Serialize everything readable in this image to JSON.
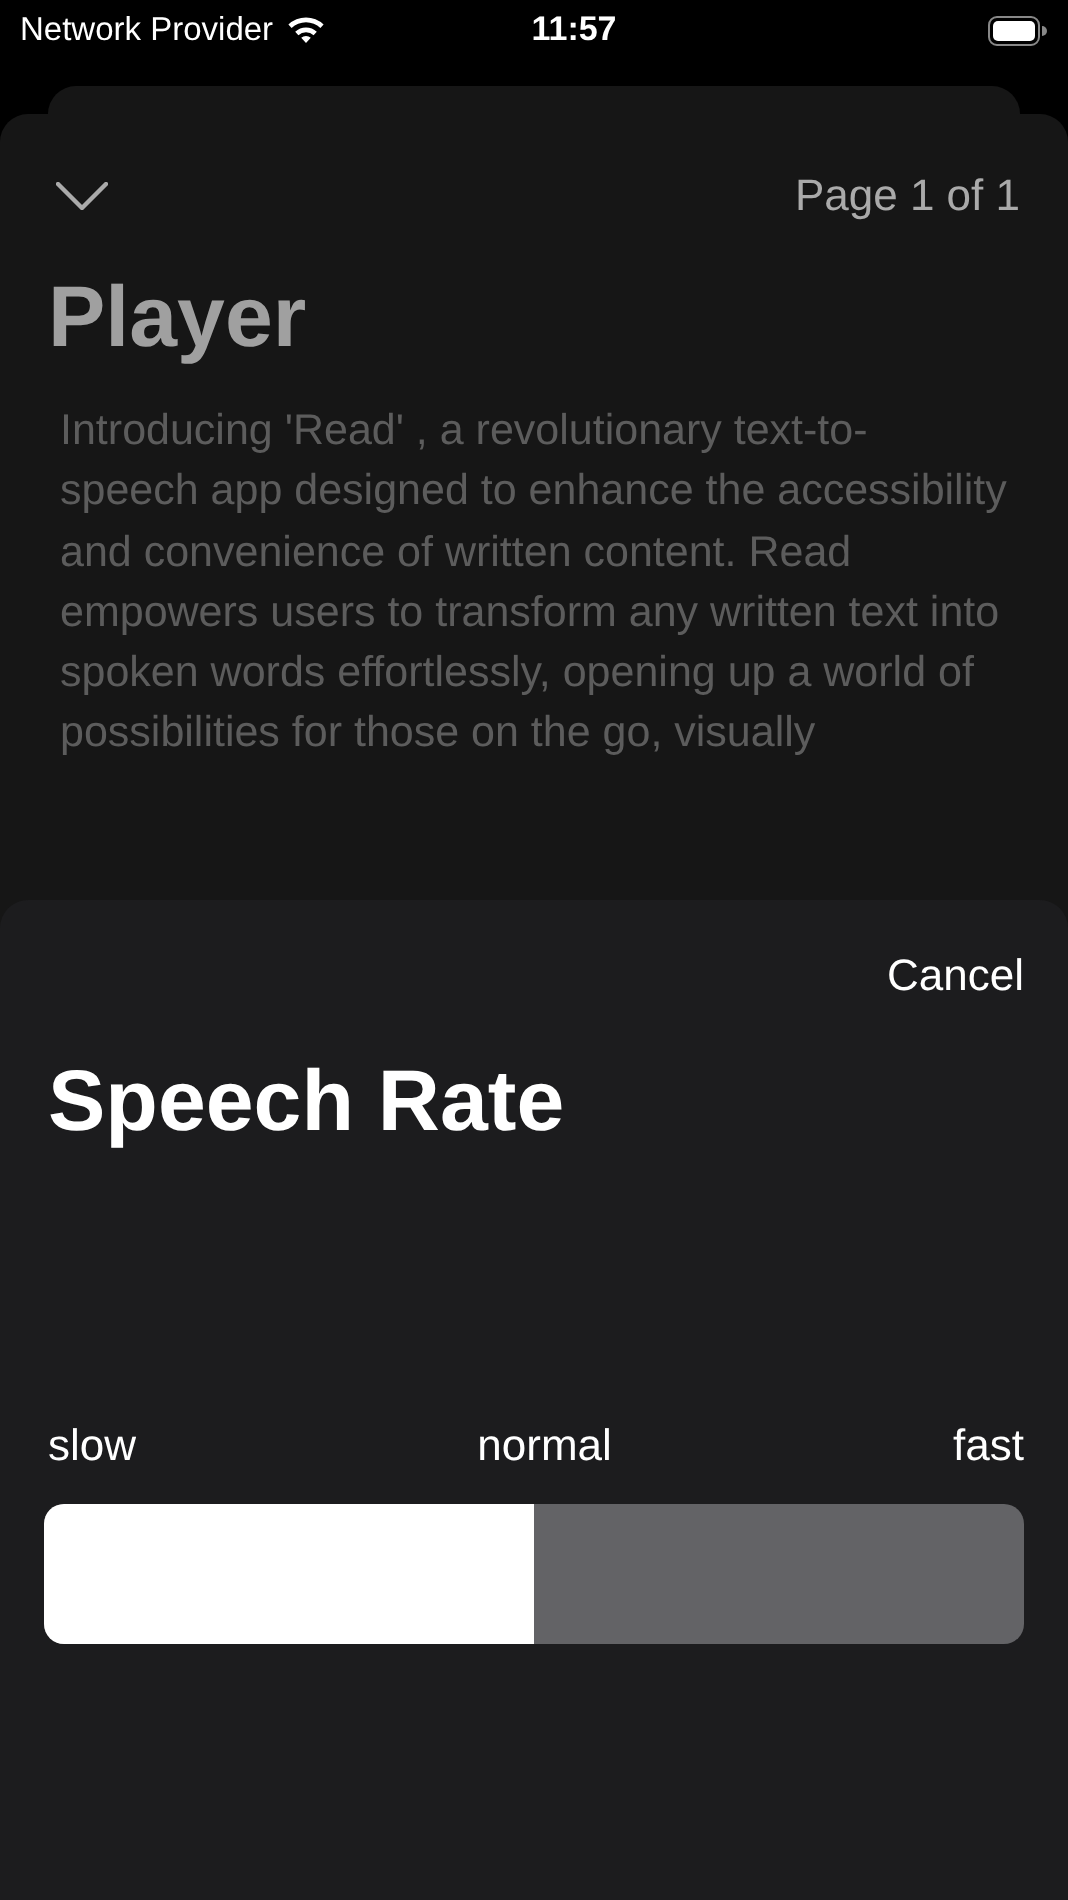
{
  "status_bar": {
    "carrier": "Network Provider",
    "time": "11:57"
  },
  "player": {
    "page_indicator": "Page 1 of 1",
    "title": "Player",
    "body": "Introducing 'Read' , a revolutionary text-to- speech app designed to enhance the accessibility and convenience of written content. Read empowers users to transform any written text into spoken words effortlessly, opening up a world of possibilities for those on the go, visually"
  },
  "speech_rate_sheet": {
    "cancel": "Cancel",
    "title": "Speech Rate",
    "scale_labels": [
      "slow",
      "normal",
      "fast"
    ],
    "slider": {
      "level": 0.5
    }
  }
}
